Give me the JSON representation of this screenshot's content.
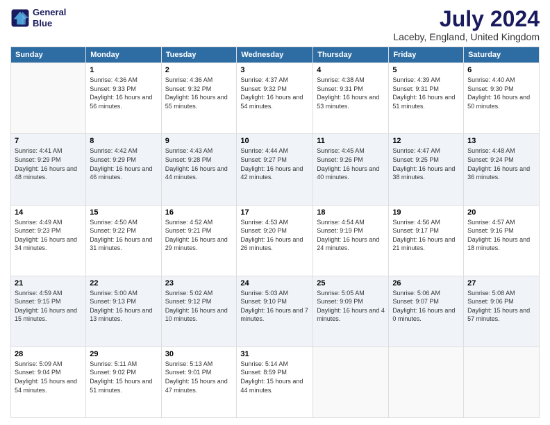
{
  "logo": {
    "line1": "General",
    "line2": "Blue"
  },
  "title": "July 2024",
  "subtitle": "Laceby, England, United Kingdom",
  "header_days": [
    "Sunday",
    "Monday",
    "Tuesday",
    "Wednesday",
    "Thursday",
    "Friday",
    "Saturday"
  ],
  "weeks": [
    [
      {
        "day": "",
        "sunrise": "",
        "sunset": "",
        "daylight": ""
      },
      {
        "day": "1",
        "sunrise": "Sunrise: 4:36 AM",
        "sunset": "Sunset: 9:33 PM",
        "daylight": "Daylight: 16 hours and 56 minutes."
      },
      {
        "day": "2",
        "sunrise": "Sunrise: 4:36 AM",
        "sunset": "Sunset: 9:32 PM",
        "daylight": "Daylight: 16 hours and 55 minutes."
      },
      {
        "day": "3",
        "sunrise": "Sunrise: 4:37 AM",
        "sunset": "Sunset: 9:32 PM",
        "daylight": "Daylight: 16 hours and 54 minutes."
      },
      {
        "day": "4",
        "sunrise": "Sunrise: 4:38 AM",
        "sunset": "Sunset: 9:31 PM",
        "daylight": "Daylight: 16 hours and 53 minutes."
      },
      {
        "day": "5",
        "sunrise": "Sunrise: 4:39 AM",
        "sunset": "Sunset: 9:31 PM",
        "daylight": "Daylight: 16 hours and 51 minutes."
      },
      {
        "day": "6",
        "sunrise": "Sunrise: 4:40 AM",
        "sunset": "Sunset: 9:30 PM",
        "daylight": "Daylight: 16 hours and 50 minutes."
      }
    ],
    [
      {
        "day": "7",
        "sunrise": "Sunrise: 4:41 AM",
        "sunset": "Sunset: 9:29 PM",
        "daylight": "Daylight: 16 hours and 48 minutes."
      },
      {
        "day": "8",
        "sunrise": "Sunrise: 4:42 AM",
        "sunset": "Sunset: 9:29 PM",
        "daylight": "Daylight: 16 hours and 46 minutes."
      },
      {
        "day": "9",
        "sunrise": "Sunrise: 4:43 AM",
        "sunset": "Sunset: 9:28 PM",
        "daylight": "Daylight: 16 hours and 44 minutes."
      },
      {
        "day": "10",
        "sunrise": "Sunrise: 4:44 AM",
        "sunset": "Sunset: 9:27 PM",
        "daylight": "Daylight: 16 hours and 42 minutes."
      },
      {
        "day": "11",
        "sunrise": "Sunrise: 4:45 AM",
        "sunset": "Sunset: 9:26 PM",
        "daylight": "Daylight: 16 hours and 40 minutes."
      },
      {
        "day": "12",
        "sunrise": "Sunrise: 4:47 AM",
        "sunset": "Sunset: 9:25 PM",
        "daylight": "Daylight: 16 hours and 38 minutes."
      },
      {
        "day": "13",
        "sunrise": "Sunrise: 4:48 AM",
        "sunset": "Sunset: 9:24 PM",
        "daylight": "Daylight: 16 hours and 36 minutes."
      }
    ],
    [
      {
        "day": "14",
        "sunrise": "Sunrise: 4:49 AM",
        "sunset": "Sunset: 9:23 PM",
        "daylight": "Daylight: 16 hours and 34 minutes."
      },
      {
        "day": "15",
        "sunrise": "Sunrise: 4:50 AM",
        "sunset": "Sunset: 9:22 PM",
        "daylight": "Daylight: 16 hours and 31 minutes."
      },
      {
        "day": "16",
        "sunrise": "Sunrise: 4:52 AM",
        "sunset": "Sunset: 9:21 PM",
        "daylight": "Daylight: 16 hours and 29 minutes."
      },
      {
        "day": "17",
        "sunrise": "Sunrise: 4:53 AM",
        "sunset": "Sunset: 9:20 PM",
        "daylight": "Daylight: 16 hours and 26 minutes."
      },
      {
        "day": "18",
        "sunrise": "Sunrise: 4:54 AM",
        "sunset": "Sunset: 9:19 PM",
        "daylight": "Daylight: 16 hours and 24 minutes."
      },
      {
        "day": "19",
        "sunrise": "Sunrise: 4:56 AM",
        "sunset": "Sunset: 9:17 PM",
        "daylight": "Daylight: 16 hours and 21 minutes."
      },
      {
        "day": "20",
        "sunrise": "Sunrise: 4:57 AM",
        "sunset": "Sunset: 9:16 PM",
        "daylight": "Daylight: 16 hours and 18 minutes."
      }
    ],
    [
      {
        "day": "21",
        "sunrise": "Sunrise: 4:59 AM",
        "sunset": "Sunset: 9:15 PM",
        "daylight": "Daylight: 16 hours and 15 minutes."
      },
      {
        "day": "22",
        "sunrise": "Sunrise: 5:00 AM",
        "sunset": "Sunset: 9:13 PM",
        "daylight": "Daylight: 16 hours and 13 minutes."
      },
      {
        "day": "23",
        "sunrise": "Sunrise: 5:02 AM",
        "sunset": "Sunset: 9:12 PM",
        "daylight": "Daylight: 16 hours and 10 minutes."
      },
      {
        "day": "24",
        "sunrise": "Sunrise: 5:03 AM",
        "sunset": "Sunset: 9:10 PM",
        "daylight": "Daylight: 16 hours and 7 minutes."
      },
      {
        "day": "25",
        "sunrise": "Sunrise: 5:05 AM",
        "sunset": "Sunset: 9:09 PM",
        "daylight": "Daylight: 16 hours and 4 minutes."
      },
      {
        "day": "26",
        "sunrise": "Sunrise: 5:06 AM",
        "sunset": "Sunset: 9:07 PM",
        "daylight": "Daylight: 16 hours and 0 minutes."
      },
      {
        "day": "27",
        "sunrise": "Sunrise: 5:08 AM",
        "sunset": "Sunset: 9:06 PM",
        "daylight": "Daylight: 15 hours and 57 minutes."
      }
    ],
    [
      {
        "day": "28",
        "sunrise": "Sunrise: 5:09 AM",
        "sunset": "Sunset: 9:04 PM",
        "daylight": "Daylight: 15 hours and 54 minutes."
      },
      {
        "day": "29",
        "sunrise": "Sunrise: 5:11 AM",
        "sunset": "Sunset: 9:02 PM",
        "daylight": "Daylight: 15 hours and 51 minutes."
      },
      {
        "day": "30",
        "sunrise": "Sunrise: 5:13 AM",
        "sunset": "Sunset: 9:01 PM",
        "daylight": "Daylight: 15 hours and 47 minutes."
      },
      {
        "day": "31",
        "sunrise": "Sunrise: 5:14 AM",
        "sunset": "Sunset: 8:59 PM",
        "daylight": "Daylight: 15 hours and 44 minutes."
      },
      {
        "day": "",
        "sunrise": "",
        "sunset": "",
        "daylight": ""
      },
      {
        "day": "",
        "sunrise": "",
        "sunset": "",
        "daylight": ""
      },
      {
        "day": "",
        "sunrise": "",
        "sunset": "",
        "daylight": ""
      }
    ]
  ]
}
